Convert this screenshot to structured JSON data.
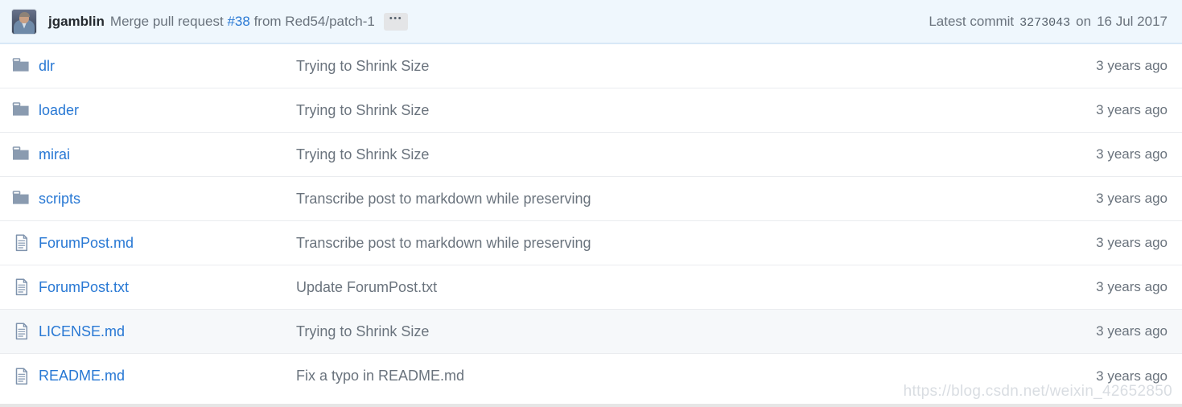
{
  "colors": {
    "link": "#2878d4",
    "muted_text": "#6a737d",
    "header_bg": "#eff7fd",
    "header_border": "#d8e8f7",
    "row_border": "#eaecef",
    "row_highlight_bg": "#f6f8fa",
    "folder_icon": "#8a9bb0",
    "file_icon": "#7f93ad",
    "watermark": "#d9dde2"
  },
  "commit_header": {
    "avatar_name": "user-avatar",
    "author": "jgamblin",
    "message_prefix": "Merge pull request",
    "pr_number": "#38",
    "message_suffix": "from Red54/patch-1",
    "ellipsis_label": "•••",
    "latest_commit_label": "Latest commit",
    "commit_sha": "3273043",
    "commit_date_prefix": "on",
    "commit_date": "16 Jul 2017"
  },
  "file_list": {
    "rows": [
      {
        "type": "folder",
        "icon": "folder-icon",
        "name": "dlr",
        "message": "Trying to Shrink Size",
        "age": "3 years ago",
        "highlight": false
      },
      {
        "type": "folder",
        "icon": "folder-icon",
        "name": "loader",
        "message": "Trying to Shrink Size",
        "age": "3 years ago",
        "highlight": false
      },
      {
        "type": "folder",
        "icon": "folder-icon",
        "name": "mirai",
        "message": "Trying to Shrink Size",
        "age": "3 years ago",
        "highlight": false
      },
      {
        "type": "folder",
        "icon": "folder-icon",
        "name": "scripts",
        "message": "Transcribe post to markdown while preserving",
        "age": "3 years ago",
        "highlight": false
      },
      {
        "type": "file",
        "icon": "file-icon",
        "name": "ForumPost.md",
        "message": "Transcribe post to markdown while preserving",
        "age": "3 years ago",
        "highlight": false
      },
      {
        "type": "file",
        "icon": "file-icon",
        "name": "ForumPost.txt",
        "message": "Update ForumPost.txt",
        "age": "3 years ago",
        "highlight": false
      },
      {
        "type": "file",
        "icon": "file-icon",
        "name": "LICENSE.md",
        "message": "Trying to Shrink Size",
        "age": "3 years ago",
        "highlight": true
      },
      {
        "type": "file",
        "icon": "file-icon",
        "name": "README.md",
        "message": "Fix a typo in README.md",
        "age": "3 years ago",
        "highlight": false
      }
    ]
  },
  "watermark": {
    "text": "https://blog.csdn.net/weixin_42652850"
  }
}
